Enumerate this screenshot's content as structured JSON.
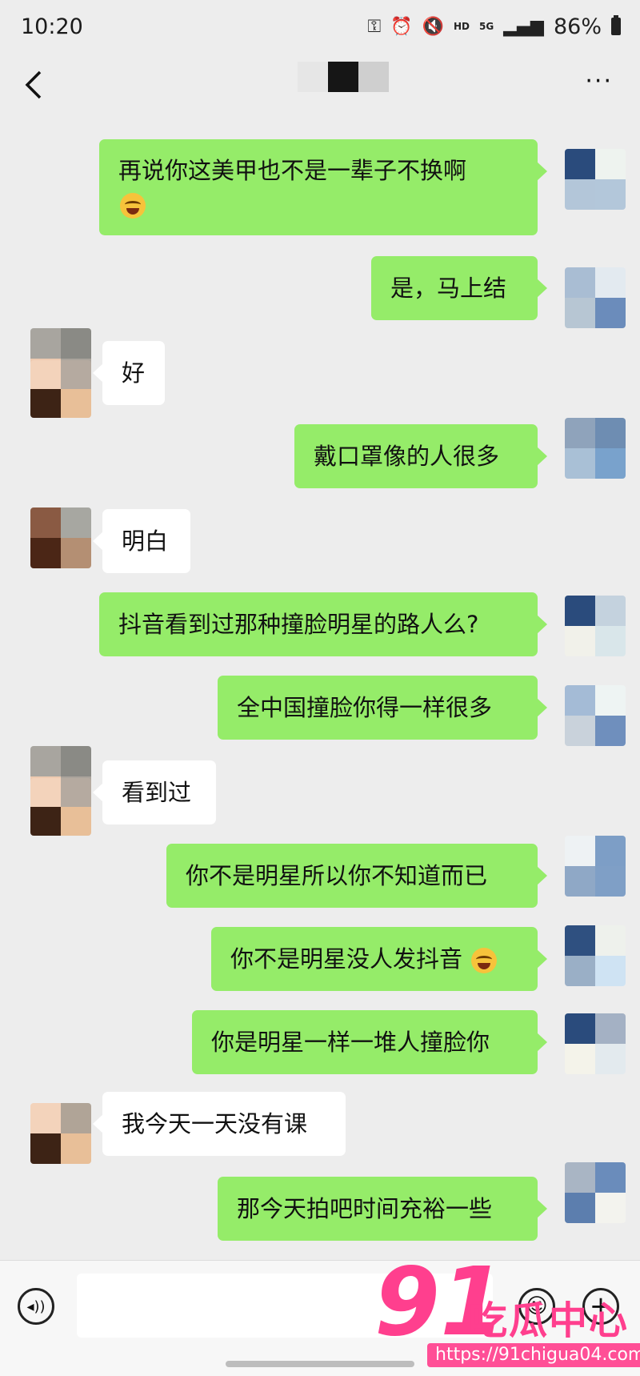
{
  "status_bar": {
    "time": "10:20",
    "hd_label": "HD",
    "network_label": "5G",
    "battery": "86%"
  },
  "nav": {
    "back_icon": "chevron-left-icon",
    "more_icon": "more-icon",
    "more_label": "···"
  },
  "messages": [
    {
      "side": "out",
      "text": "再说你这美甲也不是一辈子不换啊",
      "emoji": "laugh-cry-emoji"
    },
    {
      "side": "out",
      "text": "是，马上结"
    },
    {
      "side": "in",
      "text": "好"
    },
    {
      "side": "out",
      "text": "戴口罩像的人很多"
    },
    {
      "side": "in",
      "text": "明白"
    },
    {
      "side": "out",
      "text": "抖音看到过那种撞脸明星的路人么?"
    },
    {
      "side": "out",
      "text": "全中国撞脸你得一样很多"
    },
    {
      "side": "in",
      "text": "看到过"
    },
    {
      "side": "out",
      "text": "你不是明星所以你不知道而已"
    },
    {
      "side": "out",
      "text": "你不是明星没人发抖音",
      "emoji": "laugh-cry-emoji"
    },
    {
      "side": "out",
      "text": "你是明星一样一堆人撞脸你"
    },
    {
      "side": "in",
      "text": "我今天一天没有课"
    },
    {
      "side": "out",
      "text": "那今天拍吧时间充裕一些"
    }
  ],
  "input_bar": {
    "voice_icon": "voice-icon",
    "voice_glyph": "◂))",
    "text_value": "",
    "emoji_icon": "emoji-icon",
    "emoji_glyph": "☺",
    "plus_icon": "plus-icon",
    "plus_glyph": "+"
  },
  "watermark": {
    "logo": "91",
    "name": "吃瓜中心",
    "url": "https://91chigua04.com"
  },
  "colors": {
    "background": "#ededed",
    "outgoing_bubble": "#95ec69",
    "incoming_bubble": "#ffffff",
    "watermark": "#ff3f8e"
  }
}
